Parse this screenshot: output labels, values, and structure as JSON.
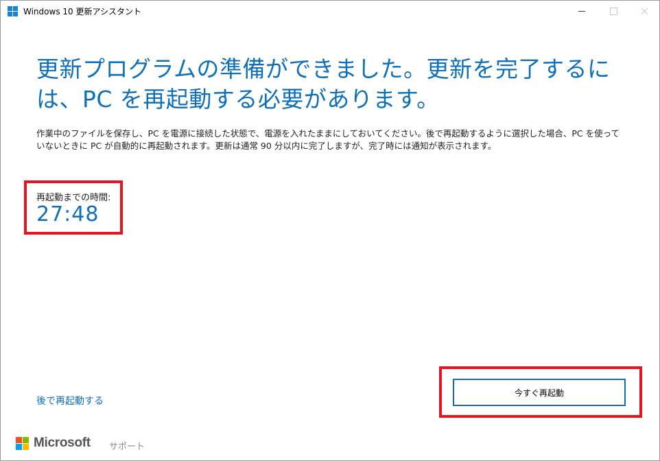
{
  "window": {
    "title": "Windows 10 更新アシスタント",
    "icon": "windows-logo-icon",
    "controls": [
      "minimize-icon",
      "maximize-icon",
      "close-icon"
    ]
  },
  "main": {
    "heading": "更新プログラムの準備ができました。更新を完了するには、PC を再起動する必要があります。",
    "description": "作業中のファイルを保存し、PC を電源に接続した状態で、電源を入れたままにしておいてください。後で再起動するように選択した場合、PC を使っていないときに PC が自動的に再起動されます。更新は通常 90 分以内に完了しますが、完了時には通知が表示されます。",
    "countdown_label": "再起動までの時間:",
    "countdown_value": "27:48"
  },
  "actions": {
    "restart_later": "後で再起動する",
    "restart_now": "今すぐ再起動"
  },
  "footer": {
    "brand": "Microsoft",
    "support": "サポート"
  },
  "colors": {
    "accent": "#0f6fb8",
    "highlight": "#e8131f"
  }
}
